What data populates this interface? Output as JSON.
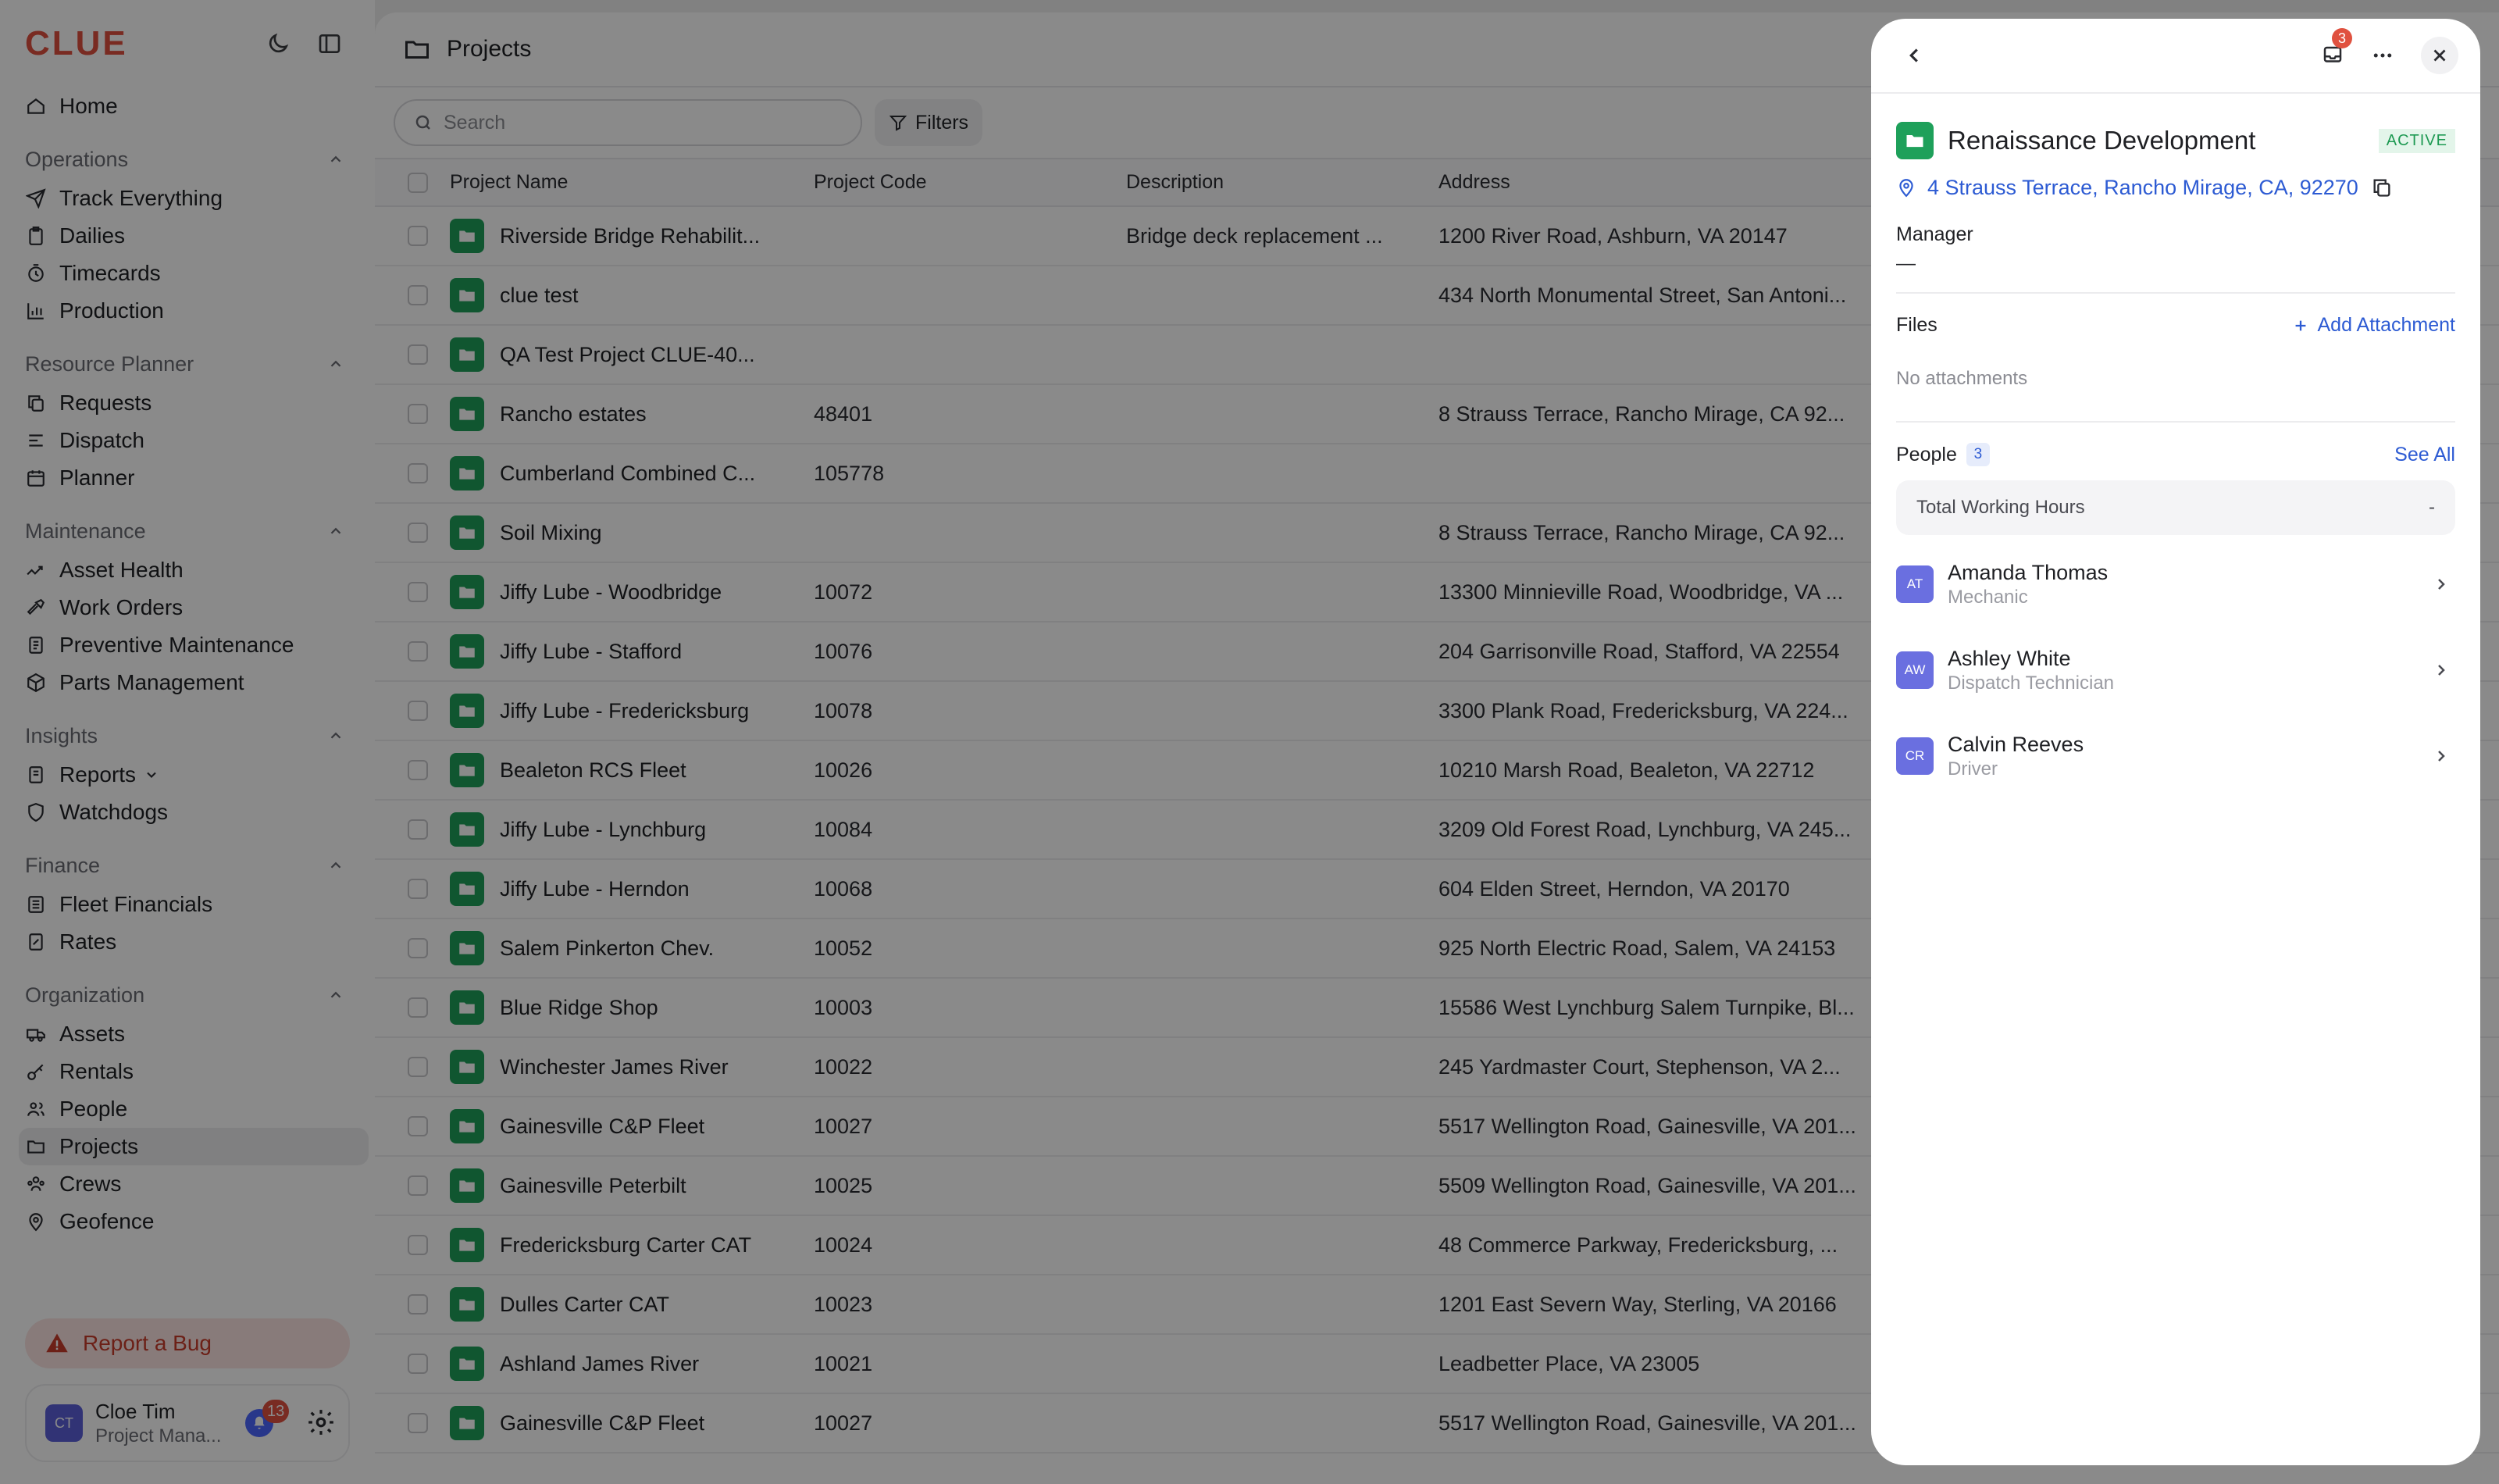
{
  "sidebar": {
    "logo": "CLUE",
    "home": "Home",
    "groups": [
      {
        "title": "Operations",
        "items": [
          "Track Everything",
          "Dailies",
          "Timecards",
          "Production"
        ]
      },
      {
        "title": "Resource Planner",
        "items": [
          "Requests",
          "Dispatch",
          "Planner"
        ]
      },
      {
        "title": "Maintenance",
        "items": [
          "Asset Health",
          "Work Orders",
          "Preventive Maintenance",
          "Parts Management"
        ]
      },
      {
        "title": "Insights",
        "items": [
          "Reports",
          "Watchdogs"
        ]
      },
      {
        "title": "Finance",
        "items": [
          "Fleet Financials",
          "Rates"
        ]
      },
      {
        "title": "Organization",
        "items": [
          "Assets",
          "Rentals",
          "People",
          "Projects",
          "Crews",
          "Geofence"
        ]
      }
    ],
    "report_bug": "Report a Bug",
    "user": {
      "initials": "CT",
      "name": "Cloe Tim",
      "role": "Project Mana...",
      "notifications": "13"
    }
  },
  "main": {
    "title": "Projects",
    "search_placeholder": "Search",
    "filters_label": "Filters",
    "columns": [
      "Project Name",
      "Project Code",
      "Description",
      "Address"
    ],
    "rows": [
      {
        "name": "Riverside Bridge Rehabilit...",
        "code": "",
        "desc": "Bridge deck replacement ...",
        "addr": "1200 River Road, Ashburn, VA 20147"
      },
      {
        "name": "clue test",
        "code": "",
        "desc": "",
        "addr": "434 North Monumental Street, San Antoni..."
      },
      {
        "name": "QA Test Project CLUE-40...",
        "code": "",
        "desc": "",
        "addr": ""
      },
      {
        "name": "Rancho estates",
        "code": "48401",
        "desc": "",
        "addr": "8 Strauss Terrace, Rancho Mirage, CA 92..."
      },
      {
        "name": "Cumberland Combined C...",
        "code": "105778",
        "desc": "",
        "addr": ""
      },
      {
        "name": "Soil Mixing",
        "code": "",
        "desc": "",
        "addr": "8 Strauss Terrace, Rancho Mirage, CA 92..."
      },
      {
        "name": "Jiffy Lube - Woodbridge",
        "code": "10072",
        "desc": "",
        "addr": "13300 Minnieville Road, Woodbridge, VA ..."
      },
      {
        "name": "Jiffy Lube - Stafford",
        "code": "10076",
        "desc": "",
        "addr": "204 Garrisonville Road, Stafford, VA 22554"
      },
      {
        "name": "Jiffy Lube - Fredericksburg",
        "code": "10078",
        "desc": "",
        "addr": "3300 Plank Road, Fredericksburg, VA 224..."
      },
      {
        "name": "Bealeton RCS Fleet",
        "code": "10026",
        "desc": "",
        "addr": "10210 Marsh Road, Bealeton, VA 22712"
      },
      {
        "name": "Jiffy Lube - Lynchburg",
        "code": "10084",
        "desc": "",
        "addr": "3209 Old Forest Road, Lynchburg, VA 245..."
      },
      {
        "name": "Jiffy Lube - Herndon",
        "code": "10068",
        "desc": "",
        "addr": "604 Elden Street, Herndon, VA 20170"
      },
      {
        "name": "Salem Pinkerton Chev.",
        "code": "10052",
        "desc": "",
        "addr": "925 North Electric Road, Salem, VA 24153"
      },
      {
        "name": "Blue Ridge Shop",
        "code": "10003",
        "desc": "",
        "addr": "15586 West Lynchburg Salem Turnpike, Bl..."
      },
      {
        "name": "Winchester James River",
        "code": "10022",
        "desc": "",
        "addr": "245 Yardmaster Court, Stephenson, VA 2..."
      },
      {
        "name": "Gainesville C&P Fleet",
        "code": "10027",
        "desc": "",
        "addr": "5517 Wellington Road, Gainesville, VA 201..."
      },
      {
        "name": "Gainesville Peterbilt",
        "code": "10025",
        "desc": "",
        "addr": "5509 Wellington Road, Gainesville, VA 201..."
      },
      {
        "name": "Fredericksburg Carter CAT",
        "code": "10024",
        "desc": "",
        "addr": "48 Commerce Parkway, Fredericksburg, ..."
      },
      {
        "name": "Dulles Carter CAT",
        "code": "10023",
        "desc": "",
        "addr": "1201 East Severn Way, Sterling, VA 20166"
      },
      {
        "name": "Ashland James River",
        "code": "10021",
        "desc": "",
        "addr": "Leadbetter Place, VA 23005"
      },
      {
        "name": "Gainesville C&P Fleet",
        "code": "10027",
        "desc": "",
        "addr": "5517 Wellington Road, Gainesville, VA 201..."
      }
    ]
  },
  "drawer": {
    "notifications": "3",
    "title": "Renaissance Development",
    "status": "ACTIVE",
    "address": "4 Strauss Terrace, Rancho Mirage, CA, 92270",
    "manager_label": "Manager",
    "manager_value": "—",
    "files_label": "Files",
    "add_attachment": "Add Attachment",
    "no_attachments": "No attachments",
    "people_label": "People",
    "people_count": "3",
    "see_all": "See All",
    "total_hours_label": "Total Working Hours",
    "total_hours_value": "-",
    "people": [
      {
        "initials": "AT",
        "name": "Amanda Thomas",
        "role": "Mechanic"
      },
      {
        "initials": "AW",
        "name": "Ashley White",
        "role": "Dispatch Technician"
      },
      {
        "initials": "CR",
        "name": "Calvin Reeves",
        "role": "Driver"
      }
    ]
  },
  "colors": {
    "brand": "#e0513f",
    "project_green": "#1ea05a",
    "link_blue": "#2d5bd3",
    "active_green": "#1e9a53"
  }
}
